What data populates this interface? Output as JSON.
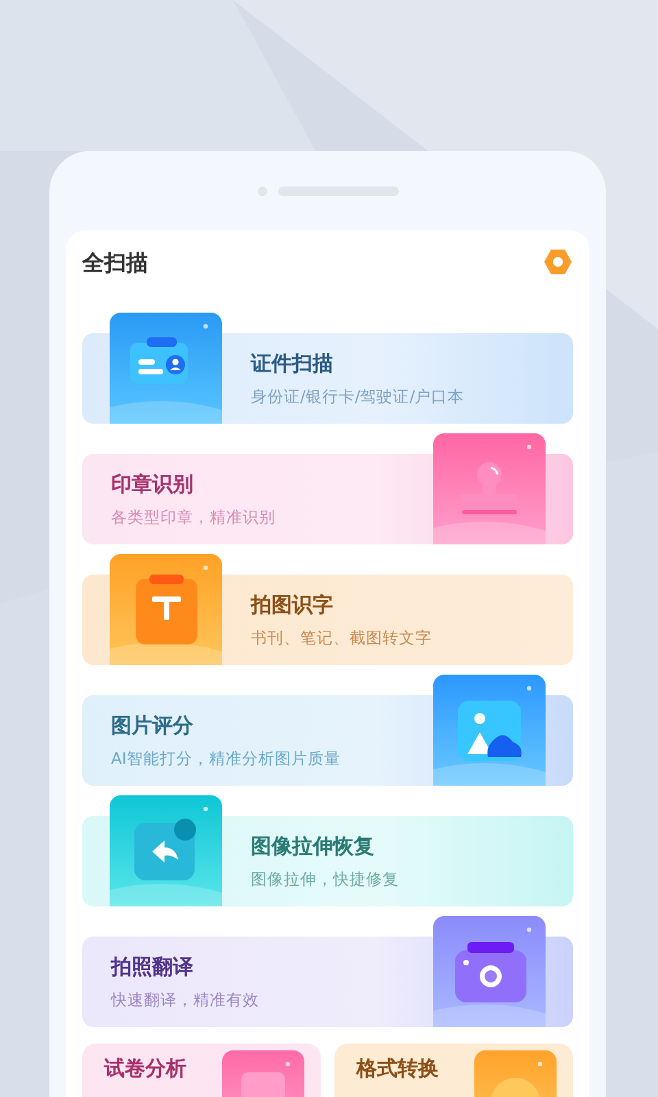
{
  "header": {
    "title": "全扫描"
  },
  "features": [
    {
      "kind": "id",
      "title": "证件扫描",
      "subtitle": "身份证/银行卡/驾驶证/户口本"
    },
    {
      "kind": "stamp",
      "title": "印章识别",
      "subtitle": "各类型印章，精准识别"
    },
    {
      "kind": "text",
      "title": "拍图识字",
      "subtitle": "书刊、笔记、截图转文字"
    },
    {
      "kind": "image",
      "title": "图片评分",
      "subtitle": "AI智能打分，精准分析图片质量"
    },
    {
      "kind": "restore",
      "title": "图像拉伸恢复",
      "subtitle": "图像拉伸，快捷修复"
    },
    {
      "kind": "camera",
      "title": "拍照翻译",
      "subtitle": "快速翻译，精准有效"
    }
  ],
  "grid_items": [
    {
      "kind": "exam",
      "title": "试卷分析"
    },
    {
      "kind": "format",
      "title": "格式转换"
    }
  ]
}
